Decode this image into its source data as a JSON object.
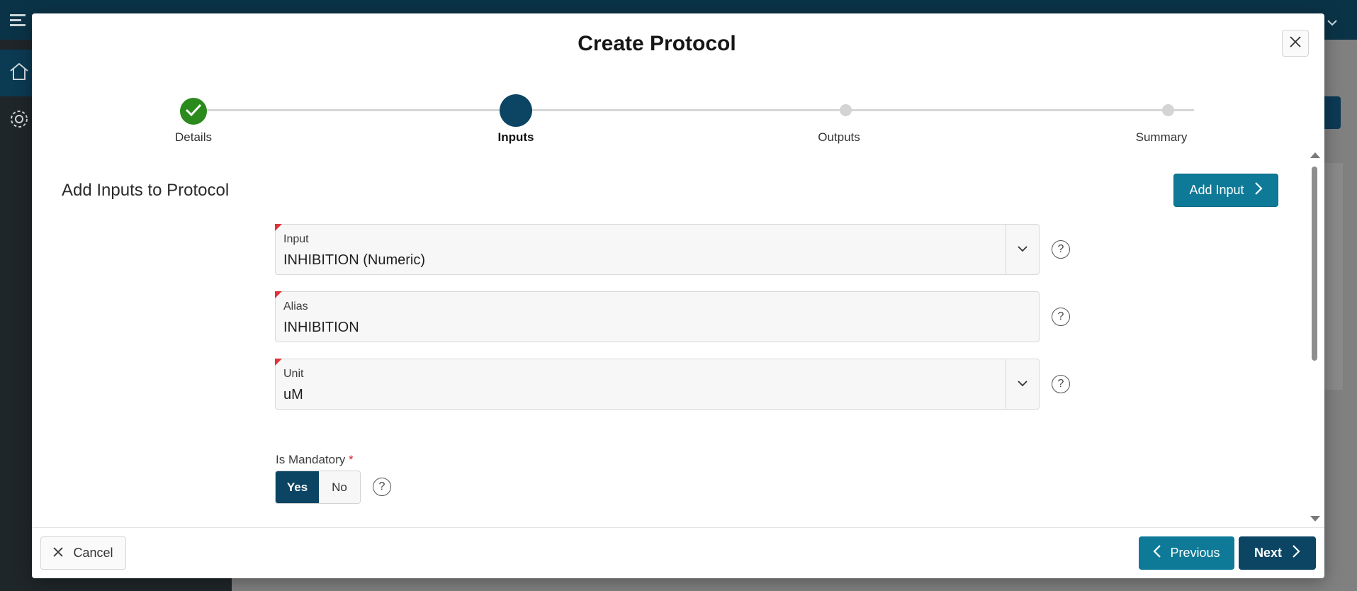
{
  "modal": {
    "title": "Create Protocol",
    "close_icon": "close-icon"
  },
  "stepper": {
    "steps": [
      {
        "label": "Details",
        "state": "completed"
      },
      {
        "label": "Inputs",
        "state": "current"
      },
      {
        "label": "Outputs",
        "state": "pending"
      },
      {
        "label": "Summary",
        "state": "pending"
      }
    ]
  },
  "section": {
    "title": "Add Inputs to Protocol",
    "add_button_label": "Add Input"
  },
  "fields": {
    "input": {
      "label": "Input",
      "value": "INHIBITION (Numeric)"
    },
    "alias": {
      "label": "Alias",
      "value": "INHIBITION"
    },
    "unit": {
      "label": "Unit",
      "value": "uM"
    },
    "help_glyph": "?"
  },
  "mandatory": {
    "label": "Is Mandatory",
    "required_marker": "*",
    "options": [
      "Yes",
      "No"
    ],
    "selected": "Yes"
  },
  "footer": {
    "cancel_label": "Cancel",
    "previous_label": "Previous",
    "next_label": "Next"
  },
  "colors": {
    "primary": "#0c4563",
    "accent": "#0e7a98",
    "success": "#2a8a1c",
    "required": "#e0323a"
  }
}
